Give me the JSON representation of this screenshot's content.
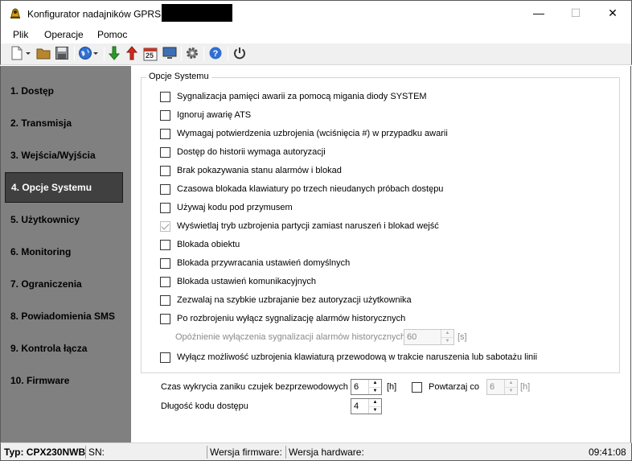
{
  "window": {
    "title": "Konfigurator nadajników GPRS",
    "min_glyph": "—",
    "max_glyph": "☐",
    "close_glyph": "✕"
  },
  "menu": {
    "items": [
      "Plik",
      "Operacje",
      "Pomoc"
    ]
  },
  "toolbar": {
    "icons": [
      "new-document-icon",
      "open-folder-icon",
      "save-icon",
      "globe-icon",
      "download-arrow-icon",
      "upload-arrow-icon",
      "calendar-icon",
      "monitor-icon",
      "gear-icon",
      "help-icon",
      "power-icon"
    ],
    "calendar_day": "25"
  },
  "sidebar": {
    "items": [
      {
        "label": "1. Dostęp"
      },
      {
        "label": "2. Transmisja"
      },
      {
        "label": "3. Wejścia/Wyjścia"
      },
      {
        "label": "4. Opcje Systemu",
        "active": true
      },
      {
        "label": "5. Użytkownicy"
      },
      {
        "label": "6. Monitoring"
      },
      {
        "label": "7. Ograniczenia"
      },
      {
        "label": "8. Powiadomienia SMS"
      },
      {
        "label": "9. Kontrola łącza"
      },
      {
        "label": "10. Firmware"
      }
    ]
  },
  "options": {
    "group_title": "Opcje Systemu",
    "checkboxes": [
      {
        "label": "Sygnalizacja pamięci awarii za pomocą migania diody SYSTEM",
        "checked": false,
        "disabled": false
      },
      {
        "label": "Ignoruj awarię ATS",
        "checked": false,
        "disabled": false
      },
      {
        "label": "Wymagaj potwierdzenia uzbrojenia (wciśnięcia #) w przypadku awarii",
        "checked": false,
        "disabled": false
      },
      {
        "label": "Dostęp do historii wymaga autoryzacji",
        "checked": false,
        "disabled": false
      },
      {
        "label": "Brak pokazywania stanu alarmów i blokad",
        "checked": false,
        "disabled": false
      },
      {
        "label": "Czasowa blokada klawiatury po trzech nieudanych próbach dostępu",
        "checked": false,
        "disabled": false
      },
      {
        "label": "Używaj kodu pod przymusem",
        "checked": false,
        "disabled": false
      },
      {
        "label": "Wyświetlaj tryb uzbrojenia partycji zamiast naruszeń i blokad wejść",
        "checked": true,
        "disabled": true
      },
      {
        "label": "Blokada obiektu",
        "checked": false,
        "disabled": false
      },
      {
        "label": "Blokada przywracania ustawień domyślnych",
        "checked": false,
        "disabled": false
      },
      {
        "label": "Blokada ustawień komunikacyjnych",
        "checked": false,
        "disabled": false
      },
      {
        "label": "Zezwalaj na szybkie uzbrajanie bez autoryzacji użytkownika",
        "checked": false,
        "disabled": false
      },
      {
        "label": "Po rozbrojeniu wyłącz sygnalizację alarmów historycznych",
        "checked": false,
        "disabled": false
      }
    ],
    "delay_label": "Opóźnienie wyłączenia sygnalizacji alarmów historycznych",
    "delay_value": "60",
    "delay_unit": "[s]",
    "last_checkbox": {
      "label": "Wyłącz możliwość uzbrojenia klawiaturą przewodową w trakcie naruszenia lub sabotażu linii",
      "checked": false
    }
  },
  "extra": {
    "wireless_label": "Czas wykrycia zaniku czujek bezprzewodowych",
    "wireless_value": "6",
    "wireless_unit": "[h]",
    "repeat_label": "Powtarzaj co",
    "repeat_value": "6",
    "repeat_unit": "[h]",
    "code_length_label": "Długość kodu dostępu",
    "code_length_value": "4"
  },
  "status": {
    "type": "Typ: CPX230NWB",
    "sn": "SN:",
    "firmware": "Wersja firmware:",
    "hardware": "Wersja hardware:",
    "time": "09:41:08"
  }
}
